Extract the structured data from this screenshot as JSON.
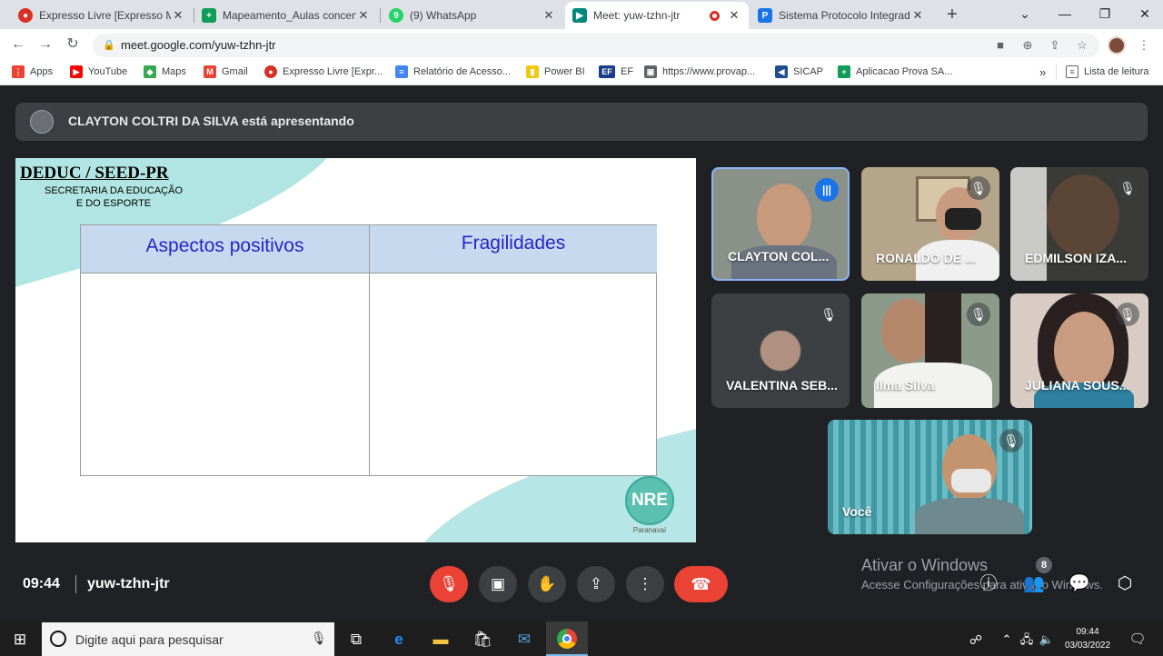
{
  "browser": {
    "tabs": [
      {
        "title": "Expresso Livre [Expresso Mai",
        "icon": "expresso-icon",
        "color": "#d93025",
        "glyph": "●"
      },
      {
        "title": "Mapeamento_Aulas concentr",
        "icon": "sheets-icon",
        "color": "#0f9d58",
        "glyph": "+"
      },
      {
        "title": "(9) WhatsApp",
        "icon": "whatsapp-icon",
        "color": "#25d366",
        "glyph": "9"
      },
      {
        "title": "Meet: yuw-tzhn-jtr",
        "icon": "meet-icon",
        "color": "#00897b",
        "glyph": "▶"
      },
      {
        "title": "Sistema Protocolo Integrado",
        "icon": "protocolo-icon",
        "color": "#1a73e8",
        "glyph": "P"
      }
    ],
    "close_glyph": "✕",
    "new_tab_glyph": "+",
    "url": "meet.google.com/yuw-tzhn-jtr",
    "bookmarks": [
      {
        "label": "Apps",
        "color": "#ea4335",
        "glyph": "⋮"
      },
      {
        "label": "YouTube",
        "color": "#ff0000",
        "glyph": "▶"
      },
      {
        "label": "Maps",
        "color": "#34a853",
        "glyph": "◆"
      },
      {
        "label": "Gmail",
        "color": "#ea4335",
        "glyph": "M"
      },
      {
        "label": "Expresso Livre [Expr...",
        "color": "#d93025",
        "glyph": "●"
      },
      {
        "label": "Relatório de Acesso...",
        "color": "#4285f4",
        "glyph": "≡"
      },
      {
        "label": "Power BI",
        "color": "#f2c811",
        "glyph": "▮"
      },
      {
        "label": "EF",
        "color": "#1a3a8a",
        "glyph": "EF"
      },
      {
        "label": "https://www.provap...",
        "color": "#5f6368",
        "glyph": "▣"
      },
      {
        "label": "SICAP",
        "color": "#1f4e8c",
        "glyph": "◀"
      },
      {
        "label": "Aplicacao Prova SA...",
        "color": "#0f9d58",
        "glyph": "+"
      }
    ],
    "overflow_glyph": "»",
    "reading_list": "Lista de leitura"
  },
  "meet": {
    "presenting_banner": "CLAYTON COLTRI DA SILVA está apresentando",
    "slide": {
      "org": "DEDUC / SEED-PR",
      "subtitle_line1": "SECRETARIA DA EDUCAÇÃO",
      "subtitle_line2": "E DO ESPORTE",
      "col1": "Aspectos positivos",
      "col2": "Fragilidades",
      "logo": "NRE",
      "logo_sub": "Paranavaí"
    },
    "participants": [
      {
        "name": "CLAYTON COL...",
        "speaking": true
      },
      {
        "name": "RONALDO DE ...",
        "muted": true
      },
      {
        "name": "EDMILSON IZA...",
        "muted": true
      },
      {
        "name": "VALENTINA SEB...",
        "muted": true
      },
      {
        "name": "Ilma Silva",
        "muted": true
      },
      {
        "name": "JULIANA SOUS...",
        "muted": true
      },
      {
        "name": "Você",
        "muted": true
      }
    ],
    "time": "09:44",
    "meeting_code": "yuw-tzhn-jtr",
    "people_count": "8"
  },
  "watermark": {
    "line1": "Ativar o Windows",
    "line2": "Acesse Configurações para ativar o Windows."
  },
  "taskbar": {
    "search_placeholder": "Digite aqui para pesquisar",
    "time": "09:44",
    "date": "03/03/2022"
  }
}
